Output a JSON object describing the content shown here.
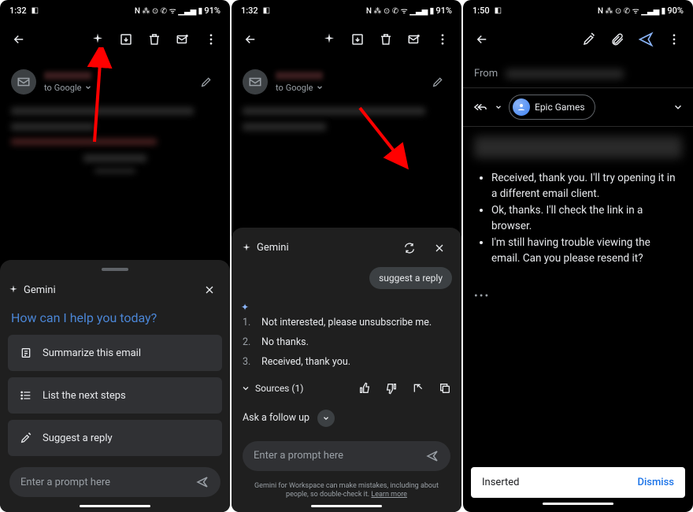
{
  "p1": {
    "time": "1:32",
    "battery": "91%",
    "to_line_prefix": "to",
    "to_line_target": "Google",
    "gemini_label": "Gemini",
    "help_text": "How can I help you today?",
    "sugg1": "Summarize this email",
    "sugg2": "List the next steps",
    "sugg3": "Suggest a reply",
    "prompt_placeholder": "Enter a prompt here"
  },
  "p2": {
    "time": "1:32",
    "battery": "91%",
    "to_line_prefix": "to",
    "to_line_target": "Google",
    "gemini_label": "Gemini",
    "chip": "suggest a reply",
    "reply1": "Not interested, please unsubscribe me.",
    "reply2": "No thanks.",
    "reply3": "Received, thank you.",
    "sources_label": "Sources (1)",
    "followup_label": "Ask a follow up",
    "prompt_placeholder": "Enter a prompt here",
    "footer_a": "Gemini for Workspace can make mistakes, including about people, so double-check it.",
    "footer_link": "Learn more"
  },
  "p3": {
    "time": "1:50",
    "battery": "90%",
    "from_label": "From",
    "recipient": "Epic Games",
    "bullets": [
      "Received, thank you. I'll try opening it in a different email client.",
      "Ok, thanks. I'll check the link in a browser.",
      "I'm still having trouble viewing the email. Can you please resend it?"
    ],
    "snackbar_msg": "Inserted",
    "snackbar_action": "Dismiss"
  }
}
